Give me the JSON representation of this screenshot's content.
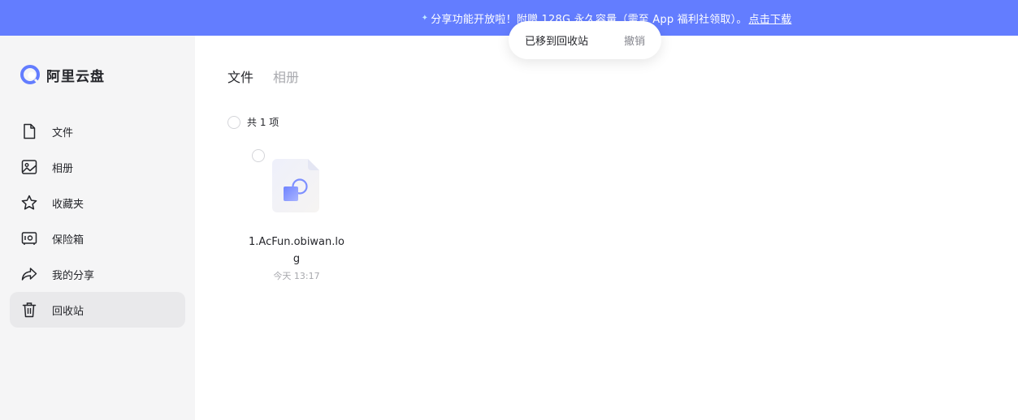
{
  "banner": {
    "text": "分享功能开放啦！附赠 128G 永久容量（需至 App 福利社领取）。",
    "link": "点击下载"
  },
  "toast": {
    "message": "已移到回收站",
    "undo": "撤销"
  },
  "app": {
    "name": "阿里云盘",
    "brand_color": "#637dff"
  },
  "sidebar": {
    "items": [
      {
        "label": "文件",
        "icon": "file-icon"
      },
      {
        "label": "相册",
        "icon": "photo-icon"
      },
      {
        "label": "收藏夹",
        "icon": "star-icon"
      },
      {
        "label": "保险箱",
        "icon": "safe-icon"
      },
      {
        "label": "我的分享",
        "icon": "share-icon"
      },
      {
        "label": "回收站",
        "icon": "trash-icon",
        "active": true
      }
    ]
  },
  "main": {
    "tabs": [
      {
        "label": "文件",
        "active": true
      },
      {
        "label": "相册",
        "active": false
      }
    ],
    "count_label": "共 1 项",
    "files": [
      {
        "name": "1.AcFun.obiwan.log",
        "time": "今天 13:17",
        "icon": "generic-file-icon"
      }
    ]
  }
}
